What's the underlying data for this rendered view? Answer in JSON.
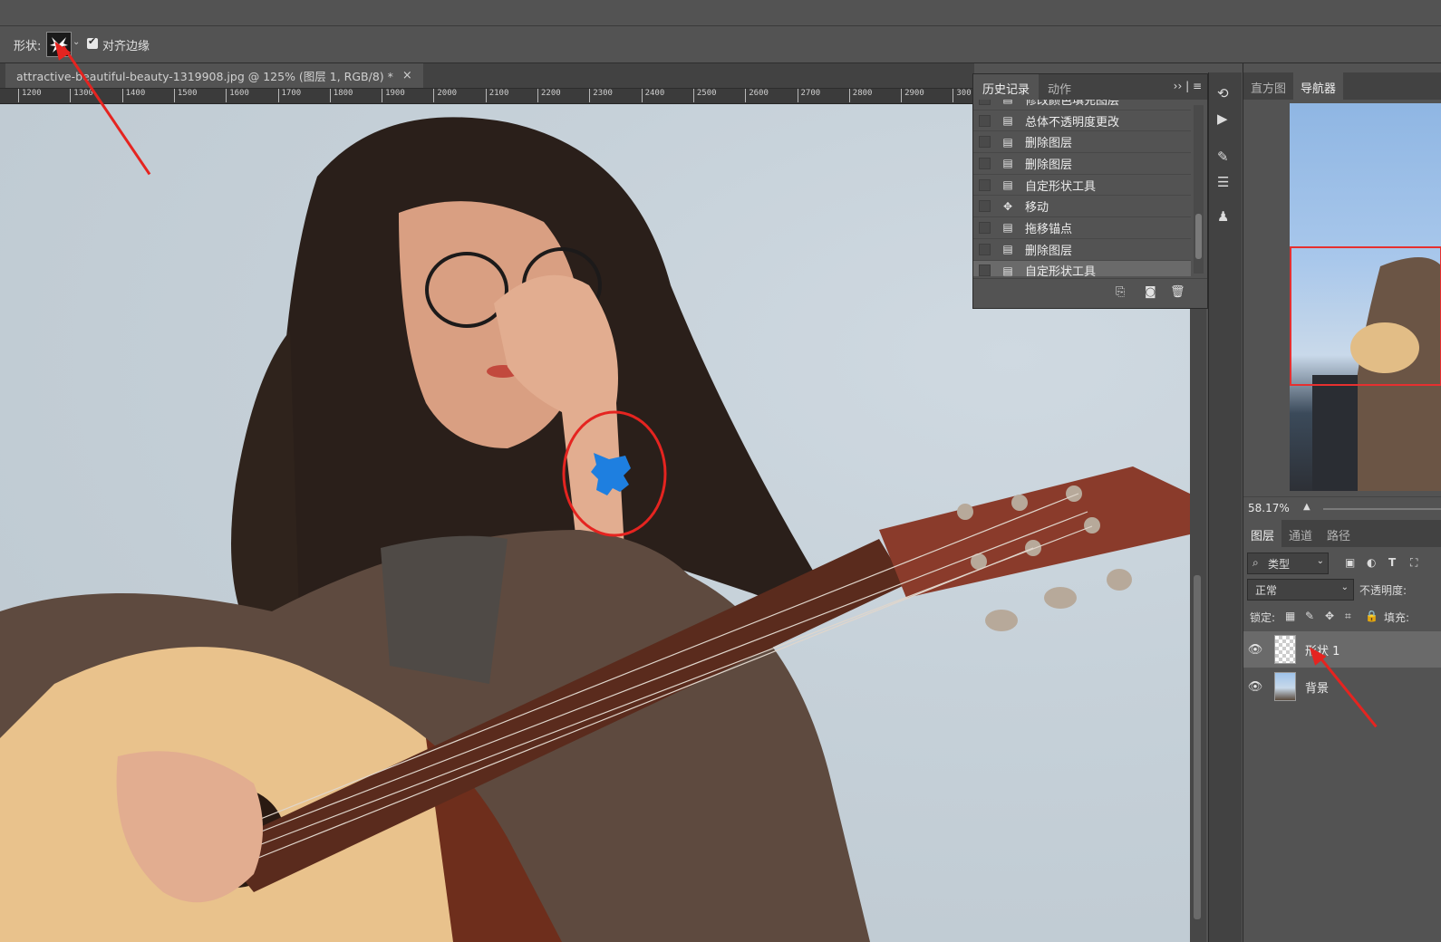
{
  "options_bar": {
    "shape_label": "形状:",
    "align_edges_label": "对齐边缘"
  },
  "document": {
    "tab_title": "attractive-beautiful-beauty-1319908.jpg  @  125% (图层 1, RGB/8) *",
    "close_glyph": "×",
    "ruler_ticks": [
      "1200",
      "1300",
      "1400",
      "1500",
      "1600",
      "1700",
      "1800",
      "1900",
      "2000",
      "2100",
      "2200",
      "2300",
      "2400",
      "2500",
      "2600",
      "2700",
      "2800",
      "2900",
      "300"
    ]
  },
  "history_panel": {
    "tabs": [
      "历史记录",
      "动作"
    ],
    "menu_glyph": "›› | ≡",
    "items": [
      {
        "label": "修改颜色填充图层",
        "icon": "doc-icon"
      },
      {
        "label": "总体不透明度更改",
        "icon": "doc-icon"
      },
      {
        "label": "删除图层",
        "icon": "doc-icon"
      },
      {
        "label": "删除图层",
        "icon": "doc-icon"
      },
      {
        "label": "自定形状工具",
        "icon": "doc-icon"
      },
      {
        "label": "移动",
        "icon": "move-icon"
      },
      {
        "label": "拖移锚点",
        "icon": "doc-icon"
      },
      {
        "label": "删除图层",
        "icon": "doc-icon"
      },
      {
        "label": "自定形状工具",
        "icon": "doc-icon",
        "selected": true
      }
    ]
  },
  "right_panel": {
    "top_tabs": [
      "直方图",
      "导航器"
    ],
    "zoom": "58.17%",
    "layers_tabs": [
      "图层",
      "通道",
      "路径"
    ],
    "filter_label": "类型",
    "blend_mode": "正常",
    "opacity_label": "不透明度:",
    "lock_label": "锁定:",
    "fill_label": "填充:",
    "layers": [
      {
        "name": "形状 1",
        "selected": true
      },
      {
        "name": "背景",
        "selected": false
      }
    ]
  },
  "colors": {
    "shape_fill": "#1e7fe0",
    "annotation_red": "#e52420"
  }
}
